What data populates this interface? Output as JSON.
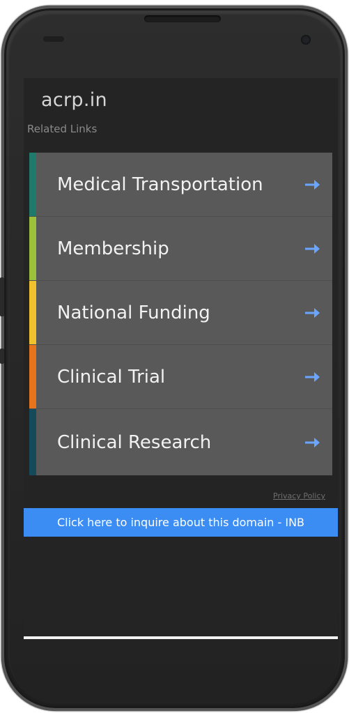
{
  "site": {
    "title": "acrp.in",
    "subtitle": "Related Links"
  },
  "links": [
    {
      "label": "Medical Transportation",
      "color": "#1f7a6c"
    },
    {
      "label": "Membership",
      "color": "#9bc13c"
    },
    {
      "label": "National Funding",
      "color": "#f2c12e"
    },
    {
      "label": "Clinical Trial",
      "color": "#e8731d"
    },
    {
      "label": "Clinical Research",
      "color": "#154a5a"
    }
  ],
  "arrow_icon": "arrow-right-icon",
  "arrow_color": "#6aa6ff",
  "footer": {
    "privacy_label": "Privacy Policy",
    "inquire_label": "Click here to inquire about this domain - INB",
    "inquire_color": "#3b8cf3"
  }
}
